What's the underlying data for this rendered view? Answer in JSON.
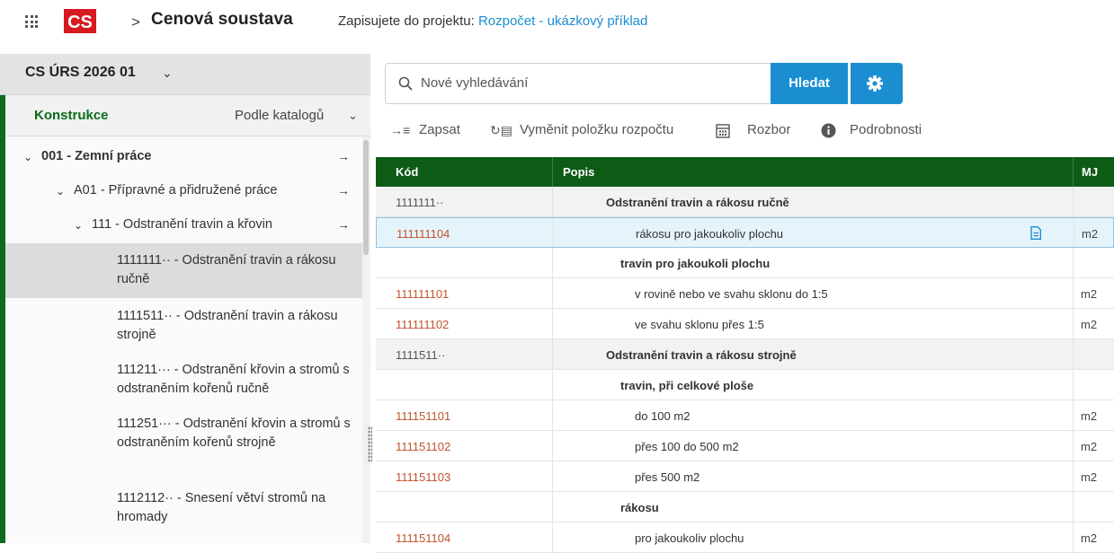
{
  "header": {
    "app_title": "Cenová soustava",
    "project_prefix": "Zapisujete do projektu:",
    "project_name": "Rozpočet - ukázkový příklad",
    "logo_text": "CS"
  },
  "left": {
    "catalog": "CS ÚRS 2026 01",
    "tab_active": "Konstrukce",
    "tab_sort": "Podle katalogů",
    "tree": [
      {
        "label": "001 - Zemní práce"
      },
      {
        "label": "A01 - Přípravné a přidružené práce"
      },
      {
        "label": "111 - Odstranění travin a křovin"
      }
    ],
    "items": [
      {
        "code": "1111111··",
        "text": "1111111·· - Odstranění travin a rákosu ručně"
      },
      {
        "code": "1111511··",
        "text": "1111511·· - Odstranění travin a rákosu strojně"
      },
      {
        "code": "111211···",
        "text": "111211··· - Odstranění křovin a stromů s odstraněním kořenů ručně"
      },
      {
        "code": "111251···",
        "text": "111251··· - Odstranění křovin a stromů s odstraněním kořenů strojně"
      },
      {
        "code": "1112112··",
        "text": "1112112·· - Snesení větví stromů na hromady"
      }
    ]
  },
  "search": {
    "placeholder": "Nové vyhledávání",
    "button": "Hledat"
  },
  "toolbar": {
    "write": "Zapsat",
    "replace": "Vyměnit položku rozpočtu",
    "analysis": "Rozbor",
    "details": "Podrobnosti"
  },
  "table": {
    "headers": {
      "code": "Kód",
      "desc": "Popis",
      "unit": "MJ"
    },
    "rows": [
      {
        "code": "1111111··",
        "desc": "Odstranění travin a rákosu ručně",
        "unit": "",
        "type": "group"
      },
      {
        "code": "111111104",
        "desc": "rákosu pro jakoukoliv plochu",
        "unit": "m2",
        "type": "selected"
      },
      {
        "code": "",
        "desc": "travin pro jakoukoli plochu",
        "unit": "",
        "type": "subgroup"
      },
      {
        "code": "111111101",
        "desc": "v rovině nebo ve svahu sklonu do 1:5",
        "unit": "m2",
        "type": "item"
      },
      {
        "code": "111111102",
        "desc": "ve svahu sklonu přes 1:5",
        "unit": "m2",
        "type": "item"
      },
      {
        "code": "1111511··",
        "desc": "Odstranění travin a rákosu strojně",
        "unit": "",
        "type": "group"
      },
      {
        "code": "",
        "desc": "travin, při celkové ploše",
        "unit": "",
        "type": "subgroup"
      },
      {
        "code": "111151101",
        "desc": "do 100 m2",
        "unit": "m2",
        "type": "item"
      },
      {
        "code": "111151102",
        "desc": "přes 100 do 500 m2",
        "unit": "m2",
        "type": "item"
      },
      {
        "code": "111151103",
        "desc": "přes 500 m2",
        "unit": "m2",
        "type": "item"
      },
      {
        "code": "",
        "desc": "rákosu",
        "unit": "",
        "type": "subgroup"
      },
      {
        "code": "111151104",
        "desc": "pro jakoukoliv plochu",
        "unit": "m2",
        "type": "item"
      }
    ]
  },
  "colors": {
    "brand_green": "#0d5c16",
    "accent_blue": "#1a8ed1",
    "code_orange": "#c1542c",
    "logo_red": "#d71920"
  }
}
